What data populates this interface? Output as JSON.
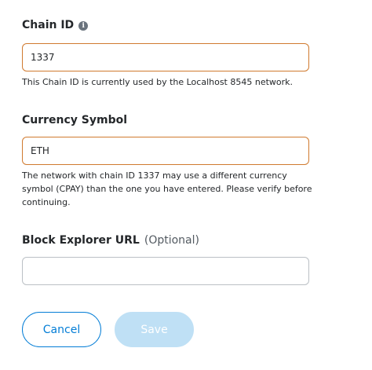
{
  "chain_id": {
    "label": "Chain ID",
    "info_icon": "info-icon",
    "value": "1337",
    "helper": "This Chain ID is currently used by the Localhost 8545 network."
  },
  "currency_symbol": {
    "label": "Currency Symbol",
    "value": "ETH",
    "helper": "The network with chain ID 1337 may use a different currency symbol (CPAY) than the one you have entered. Please verify before continuing."
  },
  "block_explorer": {
    "label": "Block Explorer URL",
    "optional": "(Optional)",
    "value": ""
  },
  "actions": {
    "cancel_label": "Cancel",
    "save_label": "Save"
  },
  "colors": {
    "warning_border": "#d07a2f",
    "primary": "#037dd6",
    "disabled_primary": "#bfe0f5"
  }
}
